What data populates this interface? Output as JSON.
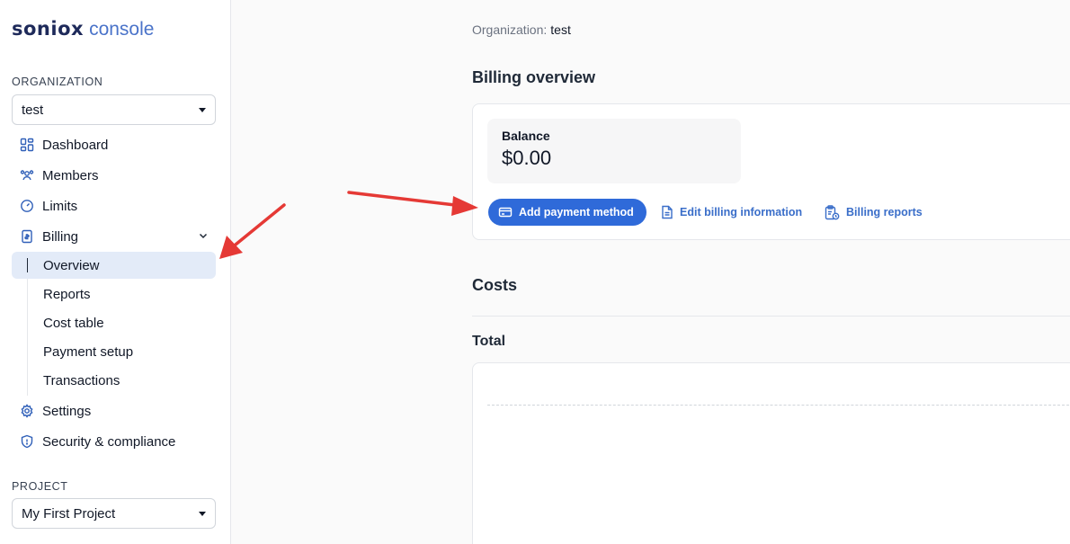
{
  "logo": {
    "brand": "soniox",
    "sub": "console"
  },
  "sidebar": {
    "org_label": "ORGANIZATION",
    "org_value": "test",
    "items": [
      {
        "label": "Dashboard",
        "icon": "dashboard-icon"
      },
      {
        "label": "Members",
        "icon": "members-icon"
      },
      {
        "label": "Limits",
        "icon": "gauge-icon"
      },
      {
        "label": "Billing",
        "icon": "invoice-icon"
      },
      {
        "label": "Settings",
        "icon": "gear-icon"
      },
      {
        "label": "Security & compliance",
        "icon": "shield-icon"
      }
    ],
    "billing_sub": [
      {
        "label": "Overview"
      },
      {
        "label": "Reports"
      },
      {
        "label": "Cost table"
      },
      {
        "label": "Payment setup"
      },
      {
        "label": "Transactions"
      }
    ],
    "project_label": "PROJECT",
    "project_value": "My First Project"
  },
  "main": {
    "org_prefix": "Organization:",
    "org_value": "test",
    "billing_title": "Billing overview",
    "balance_label": "Balance",
    "balance_amount": "$0.00",
    "add_payment_label": "Add payment method",
    "edit_billing_label": "Edit billing information",
    "billing_reports_label": "Billing reports",
    "costs_title": "Costs",
    "total_title": "Total"
  },
  "colors": {
    "accent": "#2f6ad9",
    "active_bg": "#e3ebf8",
    "annotation": "#e53935"
  }
}
